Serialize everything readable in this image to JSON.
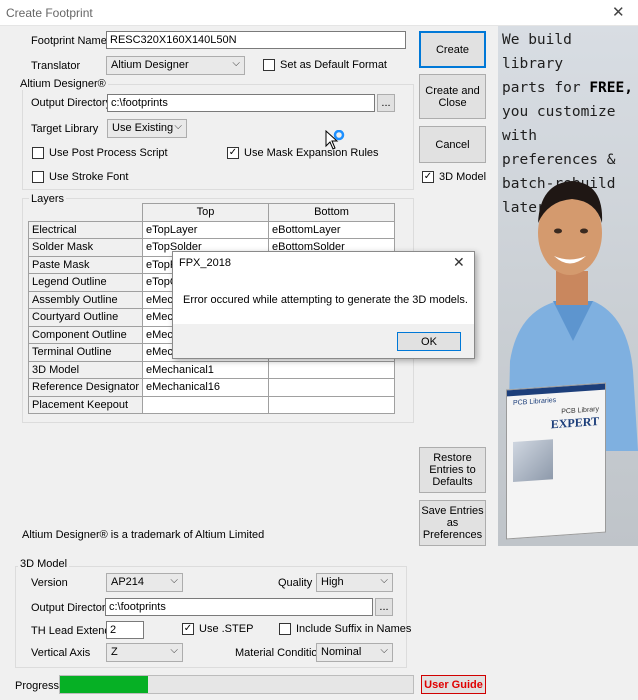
{
  "window": {
    "title": "Create Footprint",
    "close_glyph": "✕"
  },
  "form": {
    "footprint_name_label": "Footprint Name",
    "footprint_name_value": "RESC320X160X140L50N",
    "translator_label": "Translator",
    "translator_value": "Altium Designer",
    "set_default_label": "Set as Default Format",
    "set_default_checked": false,
    "group_title": "Altium Designer®",
    "output_dir_label": "Output Directory",
    "output_dir_value": "c:\\footprints",
    "browse_label": "...",
    "target_library_label": "Target Library",
    "target_library_value": "Use Existing",
    "use_post_process_label": "Use Post Process Script",
    "use_post_process_checked": false,
    "use_mask_expansion_label": "Use Mask Expansion Rules",
    "use_mask_expansion_checked": true,
    "use_stroke_font_label": "Use Stroke Font",
    "use_stroke_font_checked": false
  },
  "layers": {
    "title": "Layers",
    "col_top": "Top",
    "col_bottom": "Bottom",
    "rows": [
      {
        "name": "Electrical",
        "top": "eTopLayer",
        "bottom": "eBottomLayer"
      },
      {
        "name": "Solder Mask",
        "top": "eTopSolder",
        "bottom": "eBottomSolder"
      },
      {
        "name": "Paste Mask",
        "top": "eTopPas",
        "bottom": ""
      },
      {
        "name": "Legend Outline",
        "top": "eTopOve",
        "bottom": ""
      },
      {
        "name": "Assembly Outline",
        "top": "eMechani",
        "bottom": ""
      },
      {
        "name": "Courtyard Outline",
        "top": "eMechani",
        "bottom": ""
      },
      {
        "name": "Component Outline",
        "top": "eMechani",
        "bottom": ""
      },
      {
        "name": "Terminal Outline",
        "top": "eMechan",
        "bottom": ""
      },
      {
        "name": "3D Model",
        "top": "eMechanical1",
        "bottom": ""
      },
      {
        "name": "Reference Designator",
        "top": "eMechanical16",
        "bottom": ""
      },
      {
        "name": "Placement Keepout",
        "top": "",
        "bottom": ""
      }
    ]
  },
  "trademark": "Altium Designer® is a trademark of Altium Limited",
  "buttons": {
    "create": "Create",
    "create_close": "Create and Close",
    "cancel": "Cancel",
    "model_3d_label": "3D Model",
    "model_3d_checked": true,
    "restore": "Restore Entries to Defaults",
    "save_entries": "Save Entries as Preferences"
  },
  "model3d": {
    "group_title": "3D Model",
    "version_label": "Version",
    "version_value": "AP214",
    "quality_label": "Quality",
    "quality_value": "High",
    "output_dir_label": "Output Directory",
    "output_dir_value": "c:\\footprints",
    "browse_label": "...",
    "th_lead_label": "TH Lead Extend",
    "th_lead_value": "2",
    "use_step_label": "Use .STEP",
    "use_step_checked": true,
    "include_suffix_label": "Include Suffix in Names",
    "include_suffix_checked": false,
    "vertical_axis_label": "Vertical Axis",
    "vertical_axis_value": "Z",
    "material_label": "Material Condition",
    "material_value": "Nominal"
  },
  "status": {
    "progress_label": "Progress",
    "progress_fraction": 0.25,
    "progress_color": "#06b025",
    "user_guide": "User Guide",
    "user_guide_color": "#e00000"
  },
  "ad": {
    "line1": "We build library",
    "line2_pre": "parts for ",
    "line2_bold": "FREE,",
    "line3": "you customize",
    "line4": "with preferences &",
    "line5": "batch-rebuild later!",
    "box_brand": "PCB Libraries",
    "box_product": "PCB Library",
    "box_title": "EXPERT"
  },
  "dialog": {
    "title": "FPX_2018",
    "message": "Error occured while attempting to generate the 3D models.",
    "ok": "OK"
  }
}
